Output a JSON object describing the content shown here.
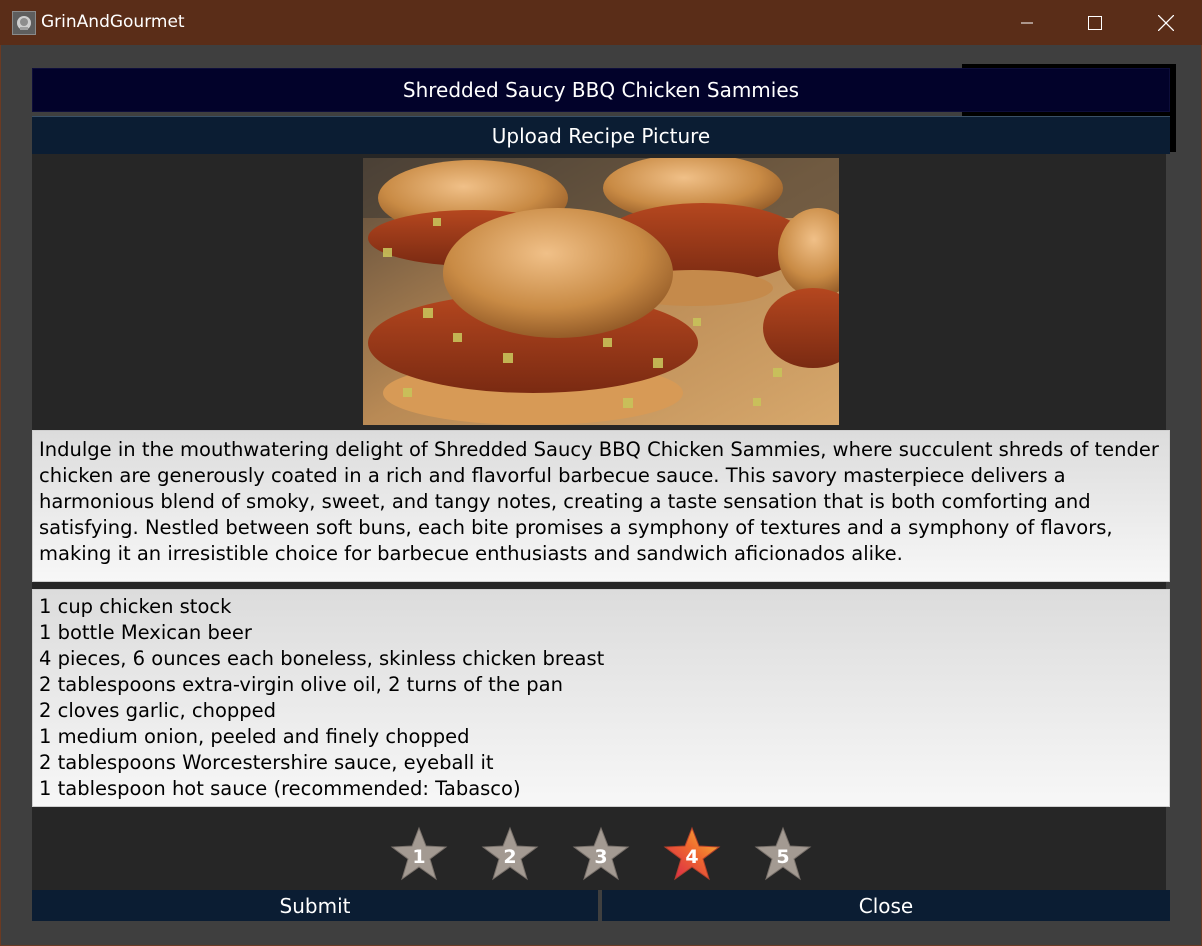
{
  "window": {
    "title": "GrinAndGourmet"
  },
  "recipe": {
    "title": "Shredded Saucy BBQ Chicken Sammies",
    "upload_label": "Upload Recipe Picture",
    "description": "Indulge in the mouthwatering delight of Shredded Saucy BBQ Chicken Sammies, where succulent shreds of tender chicken are generously coated in a rich and flavorful barbecue sauce. This savory masterpiece delivers a harmonious blend of smoky, sweet, and tangy notes, creating a taste sensation that is both comforting and satisfying. Nestled between soft buns, each bite promises a symphony of textures and a symphony of flavors, making it an irresistible choice for barbecue enthusiasts and sandwich aficionados alike.",
    "ingredients": [
      "1 cup chicken stock",
      "1 bottle Mexican beer",
      "4 pieces, 6 ounces each boneless, skinless chicken breast",
      "2 tablespoons extra-virgin olive oil, 2 turns of the pan",
      "2 cloves garlic, chopped",
      "1 medium onion, peeled and finely chopped",
      "2 tablespoons Worcestershire sauce, eyeball it",
      "1 tablespoon hot sauce (recommended: Tabasco)"
    ]
  },
  "rating": {
    "stars": [
      "1",
      "2",
      "3",
      "4",
      "5"
    ],
    "selected": 4
  },
  "actions": {
    "submit_label": "Submit",
    "close_label": "Close"
  }
}
